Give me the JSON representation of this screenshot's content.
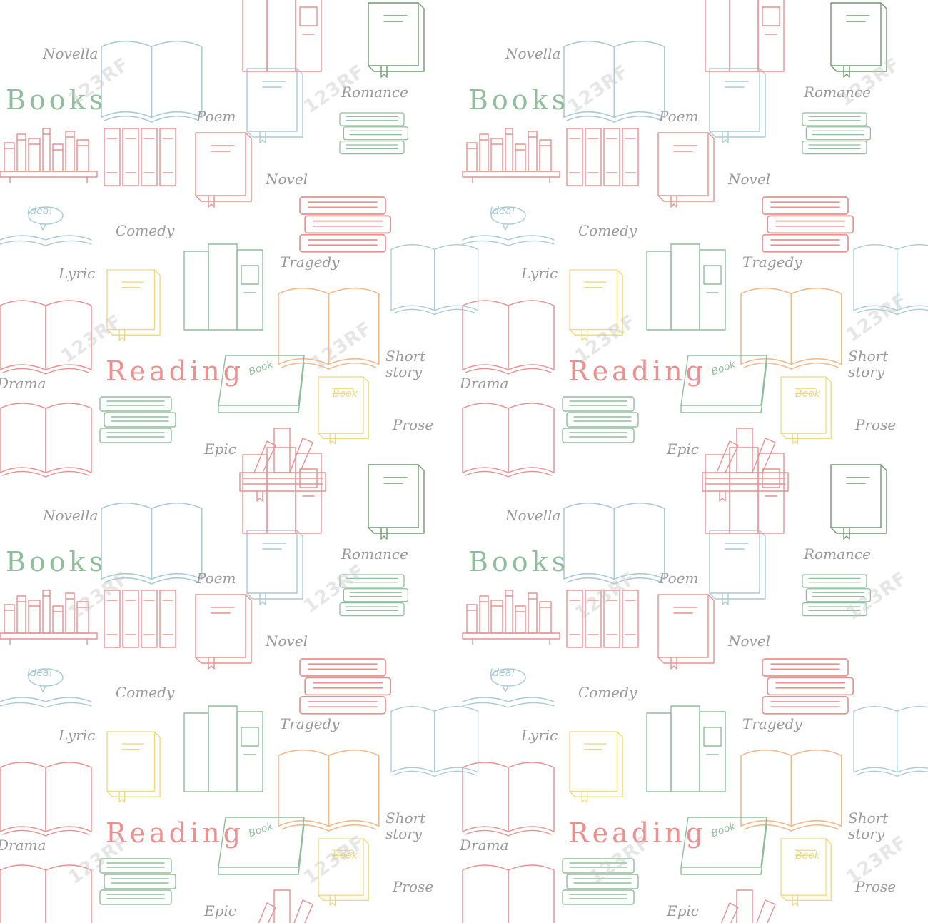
{
  "palette": {
    "green": "#8fbf9a",
    "darkgreen": "#6f9a6e",
    "red": "#ec8f8f",
    "orange": "#f2b98a",
    "yellow": "#f0d97a",
    "blue": "#a9cbd8",
    "gray": "#9a9a9a"
  },
  "labels": {
    "books": "Books",
    "reading": "Reading",
    "book": "Book",
    "idea": "Idea!",
    "novella": "Novella",
    "poem": "Poem",
    "novel": "Novel",
    "comedy": "Comedy",
    "lyric": "Lyric",
    "tragedy": "Tragedy",
    "drama": "Drama",
    "romance": "Romance",
    "short_story": "Short\nstory",
    "prose": "Prose",
    "epic": "Epic"
  },
  "watermark": "123RF",
  "icons": [
    "open-book-icon",
    "closed-book-icon",
    "book-stack-icon",
    "bookshelf-icon",
    "binder-icon",
    "book-spines-icon",
    "idea-book-icon",
    "standing-books-icon"
  ]
}
